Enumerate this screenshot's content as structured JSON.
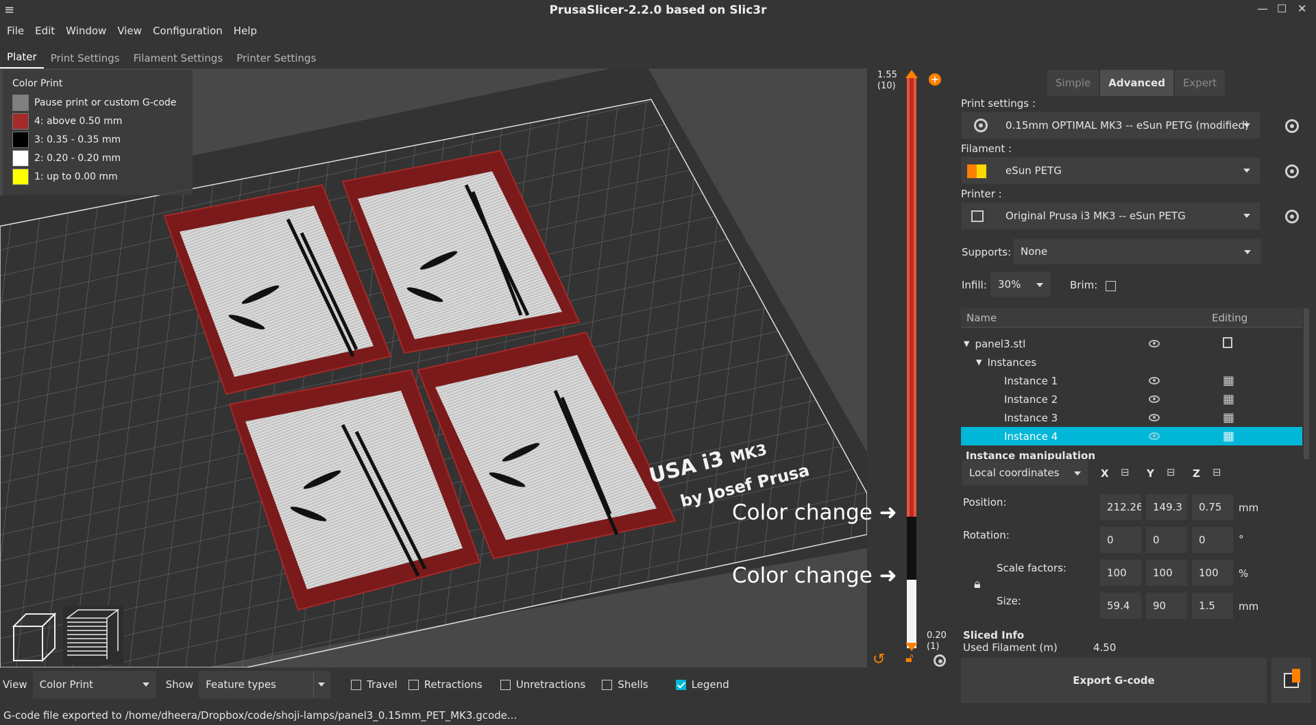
{
  "window": {
    "title": "PrusaSlicer-2.2.0 based on Slic3r"
  },
  "menu": [
    "File",
    "Edit",
    "Window",
    "View",
    "Configuration",
    "Help"
  ],
  "tabs": [
    "Plater",
    "Print Settings",
    "Filament Settings",
    "Printer Settings"
  ],
  "legend": {
    "title": "Color Print",
    "items": [
      {
        "label": "Pause print or custom G-code",
        "color": "#808080"
      },
      {
        "label": "4: above 0.50 mm",
        "color": "#a52a2a"
      },
      {
        "label": "3: 0.35 - 0.35 mm",
        "color": "#000000"
      },
      {
        "label": "2: 0.20 - 0.20 mm",
        "color": "#ffffff"
      },
      {
        "label": "1: up to 0.00 mm",
        "color": "#ffff00"
      }
    ]
  },
  "bed_label": {
    "line1": "USA i3",
    "line1b": "MK3",
    "line2": "by Josef Prusa"
  },
  "slider": {
    "top_value": "1.55",
    "top_layer": "(10)",
    "bottom_value": "0.20",
    "bottom_layer": "(1)"
  },
  "annotations": {
    "change1": "Color change",
    "change2": "Color change"
  },
  "mode": {
    "simple": "Simple",
    "advanced": "Advanced",
    "expert": "Expert"
  },
  "print_settings": {
    "label": "Print settings :",
    "value": "0.15mm OPTIMAL MK3 -- eSun PETG (modified)"
  },
  "filament": {
    "label": "Filament :",
    "value": "eSun PETG",
    "color_a": "#ff7f00",
    "color_b": "#ffd800"
  },
  "printer": {
    "label": "Printer :",
    "value": "Original Prusa i3 MK3 -- eSun PETG"
  },
  "supports": {
    "label": "Supports:",
    "value": "None"
  },
  "infill": {
    "label": "Infill:",
    "value": "30%"
  },
  "brim": {
    "label": "Brim:",
    "checked": false
  },
  "object_list": {
    "col_name": "Name",
    "col_editing": "Editing",
    "object": "panel3.stl",
    "instances_label": "Instances",
    "instances": [
      "Instance 1",
      "Instance 2",
      "Instance 3",
      "Instance 4"
    ]
  },
  "manipulation": {
    "title": "Instance manipulation",
    "coords": "Local coordinates",
    "axes": [
      "X",
      "Y",
      "Z"
    ],
    "position": {
      "label": "Position:",
      "values": [
        "212.26",
        "149.3",
        "0.75"
      ],
      "unit": "mm"
    },
    "rotation": {
      "label": "Rotation:",
      "values": [
        "0",
        "0",
        "0"
      ],
      "unit": "°"
    },
    "scale": {
      "label": "Scale factors:",
      "values": [
        "100",
        "100",
        "100"
      ],
      "unit": "%"
    },
    "size": {
      "label": "Size:",
      "values": [
        "59.4",
        "90",
        "1.5"
      ],
      "unit": "mm"
    }
  },
  "sliced_info": {
    "title": "Sliced Info",
    "filament_label": "Used Filament (m)",
    "filament_value": "4.50"
  },
  "export_button": "Export G-code",
  "bottom": {
    "view_label": "View",
    "view_value": "Color Print",
    "show_label": "Show",
    "show_value": "Feature types",
    "checkboxes": [
      {
        "label": "Travel",
        "checked": false
      },
      {
        "label": "Retractions",
        "checked": false
      },
      {
        "label": "Unretractions",
        "checked": false
      },
      {
        "label": "Shells",
        "checked": false
      },
      {
        "label": "Legend",
        "checked": true
      }
    ]
  },
  "status": "G-code file exported to /home/dheera/Dropbox/code/shoji-lamps/panel3_0.15mm_PET_MK3.gcode..."
}
